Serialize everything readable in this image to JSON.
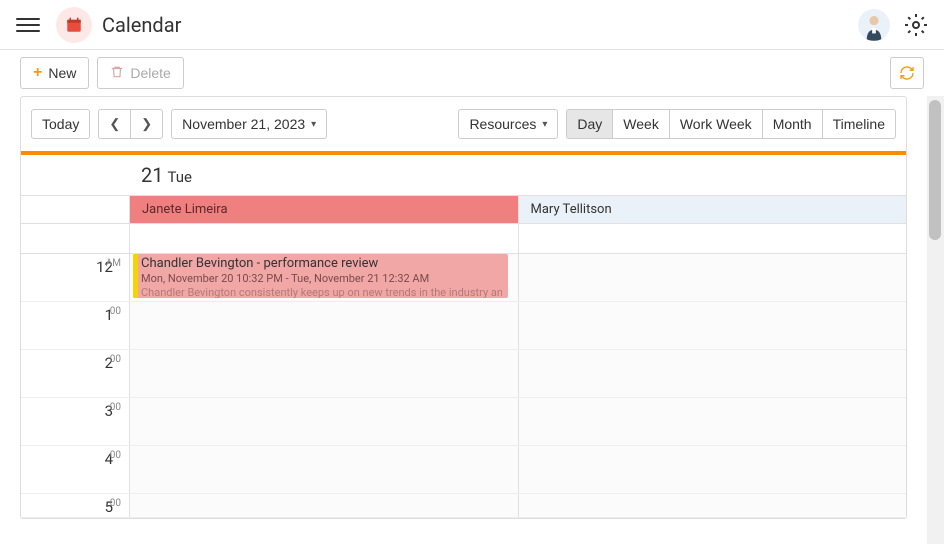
{
  "app": {
    "title": "Calendar"
  },
  "actions": {
    "new_label": "New",
    "delete_label": "Delete"
  },
  "controls": {
    "today_label": "Today",
    "date_label": "November 21, 2023",
    "resources_label": "Resources"
  },
  "views": {
    "day": "Day",
    "week": "Week",
    "work_week": "Work Week",
    "month": "Month",
    "timeline": "Timeline",
    "active": "day"
  },
  "date_header": {
    "day_number": "21",
    "day_name": "Tue"
  },
  "resources": [
    {
      "name": "Janete Limeira",
      "color": "#f08080"
    },
    {
      "name": "Mary Tellitson",
      "color": "#eaf1f8"
    }
  ],
  "hours": [
    {
      "label": "12",
      "suffix": "AM"
    },
    {
      "label": "1",
      "suffix": "00"
    },
    {
      "label": "2",
      "suffix": "00"
    },
    {
      "label": "3",
      "suffix": "00"
    },
    {
      "label": "4",
      "suffix": "00"
    },
    {
      "label": "5",
      "suffix": "00"
    }
  ],
  "event": {
    "title": "Chandler Bevington - performance review",
    "time": "Mon, November 20 10:32 PM - Tue, November 21 12:32 AM",
    "desc": "Chandler Bevington consistently keeps up on new trends in the industry and"
  }
}
